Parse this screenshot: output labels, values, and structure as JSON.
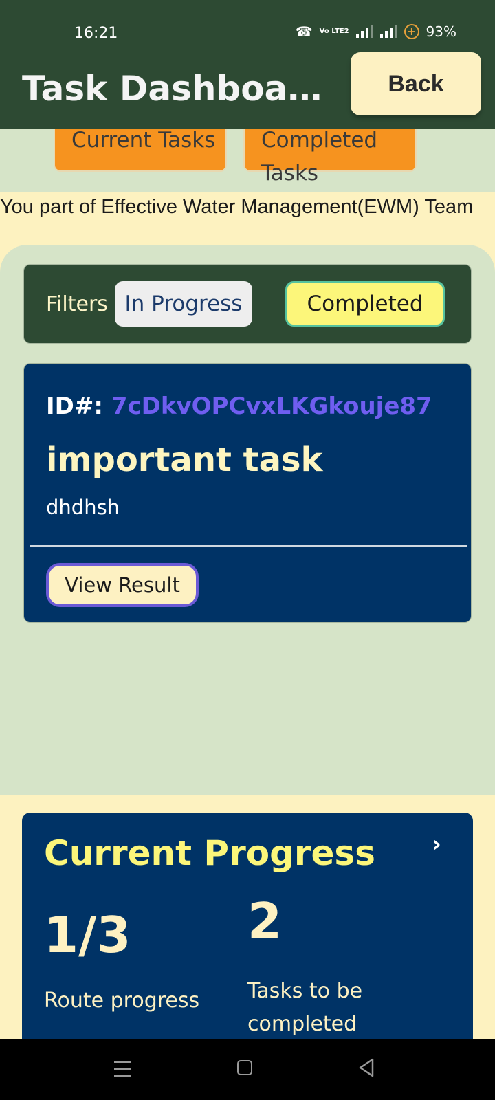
{
  "status_bar": {
    "time": "16:21",
    "volte_label": "Vo LTE2",
    "battery": "93%",
    "icons": [
      "wifi-calling-icon",
      "volte-icon",
      "signal-icon",
      "signal-icon",
      "battery-saver-icon"
    ]
  },
  "header": {
    "title": "Task Dashboard",
    "back_label": "Back"
  },
  "tabs": {
    "current_label": "Current Tasks",
    "completed_label": "Completed Tasks"
  },
  "team_text": "You part of Effective Water Management(EWM) Team",
  "filters": {
    "label": "Filters",
    "in_progress": "In Progress",
    "completed": "Completed"
  },
  "task": {
    "id_label": "ID#:",
    "id_value": "7cDkvOPCvxLKGkouje87",
    "title": "important task",
    "description": "dhdhsh",
    "view_result_label": "View Result"
  },
  "progress": {
    "title": "Current Progress",
    "route_value": "1/3",
    "route_label": "Route progress",
    "tasks_value": "2",
    "tasks_label": "Tasks to be completed"
  },
  "colors": {
    "header_bg": "#2d4a33",
    "accent_orange": "#f6931f",
    "card_bg": "#003366",
    "panel_bg": "#d6e4c8",
    "cream": "#fdf1c2",
    "yellow": "#fcf67a",
    "id_purple": "#6f5ef0"
  }
}
